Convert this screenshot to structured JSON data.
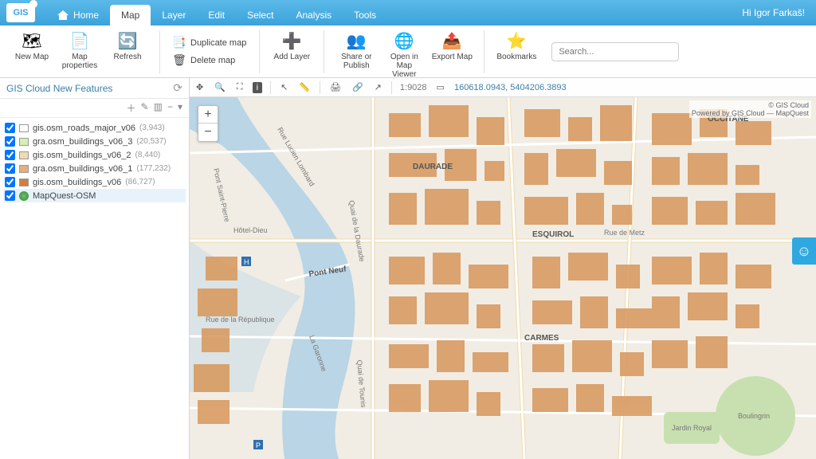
{
  "brand": "GIS",
  "user_greeting": "Hi Igor Farkaš!",
  "topnav": {
    "tabs": [
      {
        "label": "Home"
      },
      {
        "label": "Map",
        "active": true
      },
      {
        "label": "Layer"
      },
      {
        "label": "Edit"
      },
      {
        "label": "Select"
      },
      {
        "label": "Analysis"
      },
      {
        "label": "Tools"
      }
    ]
  },
  "ribbon": {
    "new_map": "New Map",
    "map_properties": "Map properties",
    "refresh": "Refresh",
    "duplicate_map": "Duplicate map",
    "delete_map": "Delete map",
    "add_layer": "Add Layer",
    "share_publish": "Share or Publish",
    "open_map_viewer": "Open in Map Viewer",
    "export_map": "Export Map",
    "bookmarks": "Bookmarks",
    "search_placeholder": "Search..."
  },
  "project": {
    "title": "GIS Cloud New Features"
  },
  "layers": [
    {
      "name": "gis.osm_roads_major_v06",
      "count": "(3,943)",
      "color": "#ffffff",
      "checked": true
    },
    {
      "name": "gra.osm_buildings_v06_3",
      "count": "(20,537)",
      "color": "#d7efb5",
      "checked": true
    },
    {
      "name": "gis.osm_buildings_v06_2",
      "count": "(8,440)",
      "color": "#f0d9b5",
      "checked": true
    },
    {
      "name": "gra.osm_buildings_v06_1",
      "count": "(177,232)",
      "color": "#e0b182",
      "checked": true
    },
    {
      "name": "gis.osm_buildings_v06",
      "count": "(86,727)",
      "color": "#d07f3f",
      "checked": true
    },
    {
      "name": "MapQuest-OSM",
      "basemap": true,
      "checked": true,
      "selected": true
    }
  ],
  "maptools": {
    "scale": "1:9028",
    "coords": "160618.0943, 5404206.3893"
  },
  "attribution": {
    "line1": "© GIS Cloud",
    "line2": "Powered by GIS Cloud — MapQuest"
  },
  "map_labels": {
    "pont_neuf": "Pont Neuf",
    "esquirol": "ESQUIROL",
    "carmes": "CARMES",
    "daurade": "DAURADE",
    "occitane": "OCCITANE",
    "jardin_royal": "Jardin Royal",
    "boulingrin": "Boulingrin",
    "rue_de_metz": "Rue de Metz",
    "hotel_dieu": "Hôtel-Dieu",
    "quai": "Quai de Tounis",
    "garonne": "La Garonne",
    "republique": "Rue de la République",
    "saint_pierre": "Pont Saint-Pierre",
    "lucien": "Rue Lucien Lombard",
    "daurade_q": "Quai de la Daurade"
  }
}
